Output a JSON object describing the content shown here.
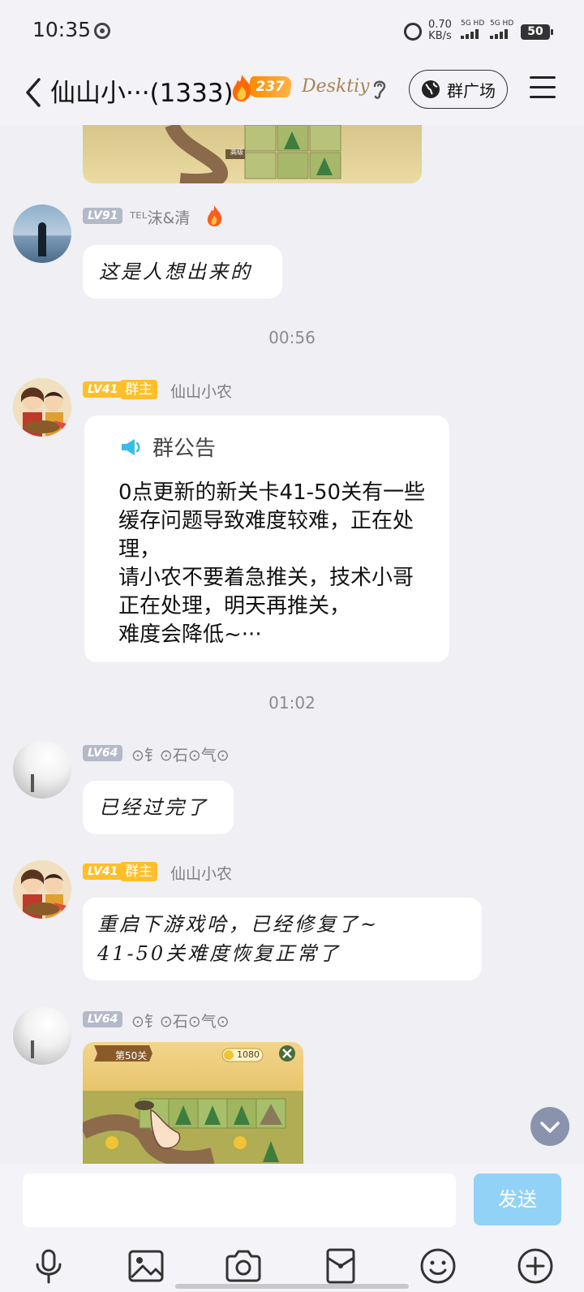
{
  "status_bar": {
    "time": "10:35",
    "net_speed_value": "0.70",
    "net_speed_unit": "KB/s",
    "sim1": "5G HD",
    "sim2": "5G HD",
    "battery": "50"
  },
  "header": {
    "title": "仙山小···(1333)",
    "fire_count": "237",
    "logo_text": "Desktiy",
    "square_label": "群广场"
  },
  "messages": [
    {
      "level": "LV91",
      "name": "ᵀᴱᴸ沫&清",
      "text": "这是人想出来的"
    },
    {
      "timestamp": "00:56"
    },
    {
      "level": "LV41",
      "role": "群主",
      "name": "仙山小农",
      "notice_title": "群公告",
      "notice_body": "0点更新的新关卡41-50关有一些缓存问题导致难度较难，正在处理，\n请小农不要着急推关，技术小哥正在处理，明天再推关，\n难度会降低~···"
    },
    {
      "timestamp": "01:02"
    },
    {
      "level": "LV64",
      "name": "⊙钅⊙石⊙气⊙",
      "text": "已经过完了"
    },
    {
      "level": "LV41",
      "role": "群主",
      "name": "仙山小农",
      "text_line1": "重启下游戏哈，已经修复了~",
      "text_line2": "41-50关难度恢复正常了"
    },
    {
      "level": "LV64",
      "name": "⊙钅⊙石⊙气⊙",
      "image_stage_label": "第50关",
      "image_coin_count": "1080"
    }
  ],
  "image_top_label": "高级",
  "input": {
    "placeholder": "",
    "send_label": "发送"
  },
  "toolbar_icons": [
    "microphone-icon",
    "image-icon",
    "camera-icon",
    "red-packet-icon",
    "emoji-icon",
    "plus-icon"
  ],
  "colors": {
    "background": "#efeff4",
    "send_button": "#92d2f7",
    "owner_badge": "#ffbf2a",
    "level_badge": "#b4b9c8"
  }
}
